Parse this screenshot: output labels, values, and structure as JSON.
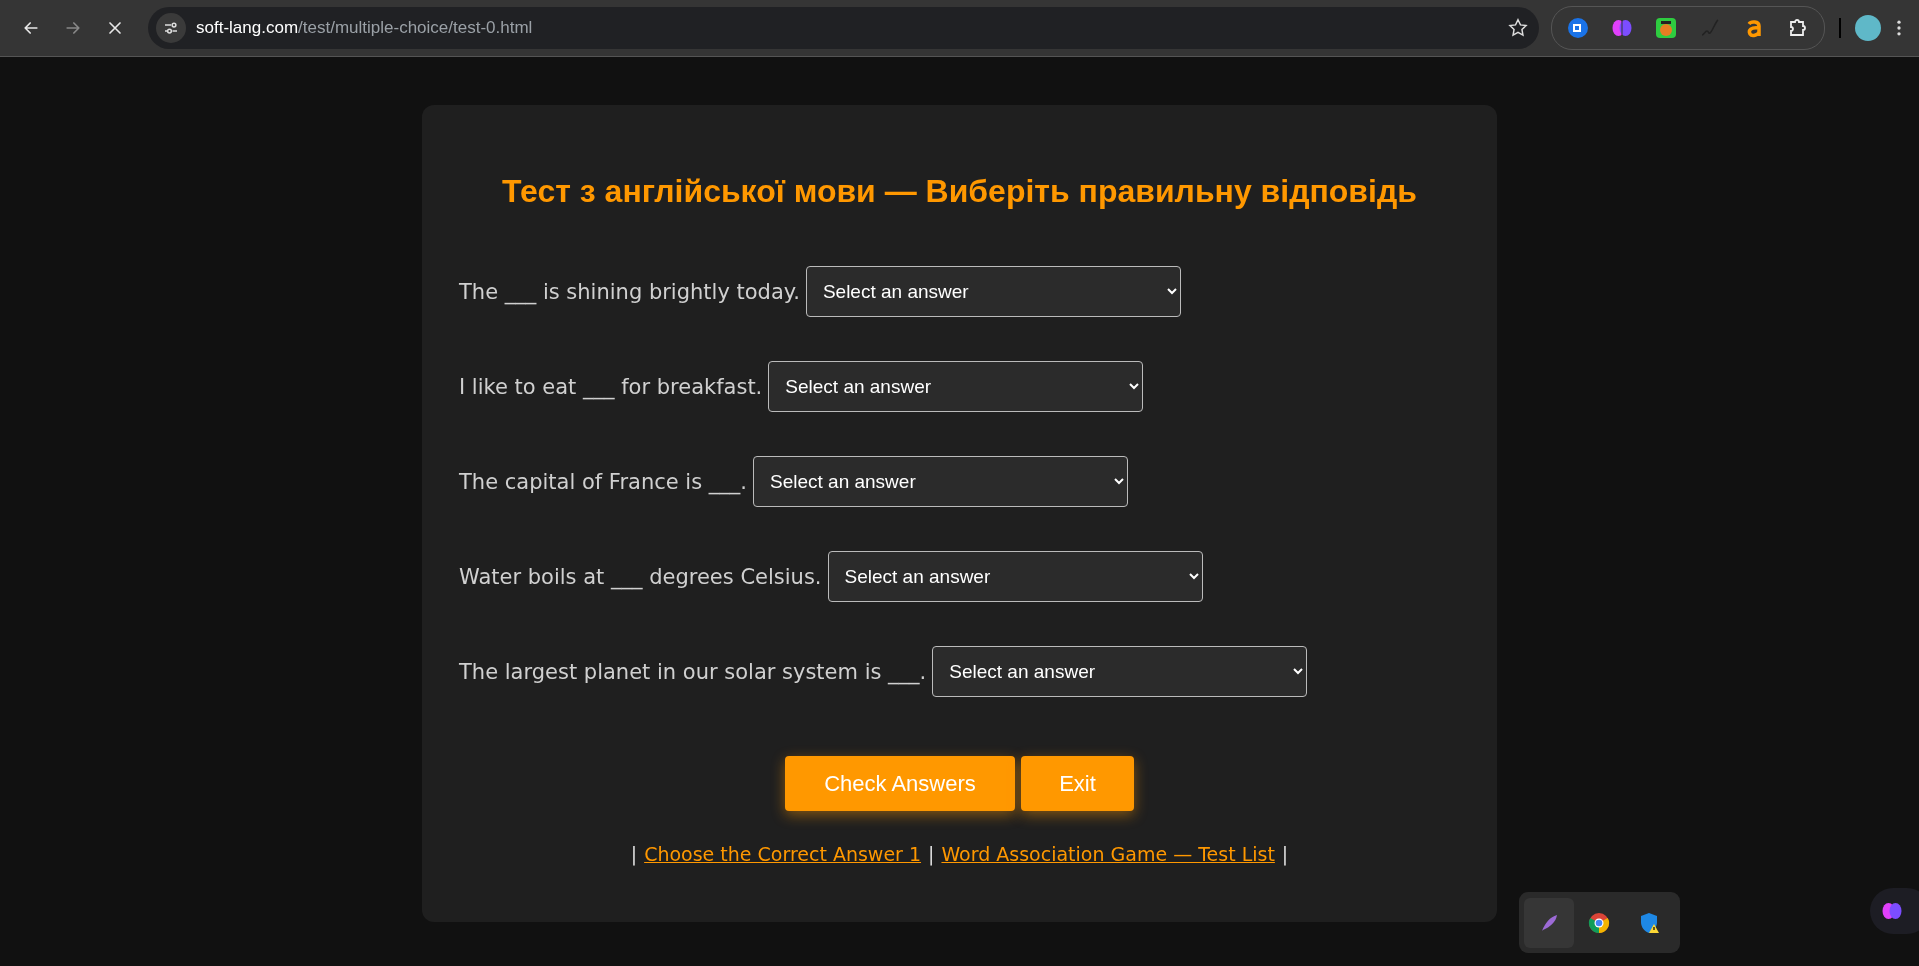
{
  "browser": {
    "back": {
      "disabled": false
    },
    "forward": {
      "disabled": true
    },
    "url_domain": "soft-lang.com",
    "url_path": "/test/multiple-choice/test-0.html",
    "bookmarked": false
  },
  "title": "Тест з англійської мови — Виберіть правильну відповідь",
  "questions": [
    {
      "text": "The ___ is shining brightly today.",
      "answer": "Select an answer"
    },
    {
      "text": "I like to eat ___ for breakfast.",
      "answer": "Select an answer"
    },
    {
      "text": "The capital of France is ___.",
      "answer": "Select an answer"
    },
    {
      "text": "Water boils at ___ degrees Celsius.",
      "answer": "Select an answer"
    },
    {
      "text": "The largest planet in our solar system is ___.",
      "answer": "Select an answer"
    }
  ],
  "buttons": [
    {
      "kind": "check",
      "label": "Check Answers"
    },
    {
      "kind": "exit",
      "label": "Exit"
    }
  ],
  "footer": [
    {
      "kind": "separator",
      "text": "|"
    },
    {
      "kind": "link",
      "text": "Choose the Correct Answer 1"
    },
    {
      "kind": "separator",
      "text": "|"
    },
    {
      "kind": "link",
      "text": "Word Association Game — Test List"
    },
    {
      "kind": "separator",
      "text": "|"
    }
  ],
  "tray": [
    {
      "kind": "feather",
      "selected": true
    },
    {
      "kind": "chrome",
      "selected": false
    },
    {
      "kind": "shield",
      "selected": false
    }
  ]
}
